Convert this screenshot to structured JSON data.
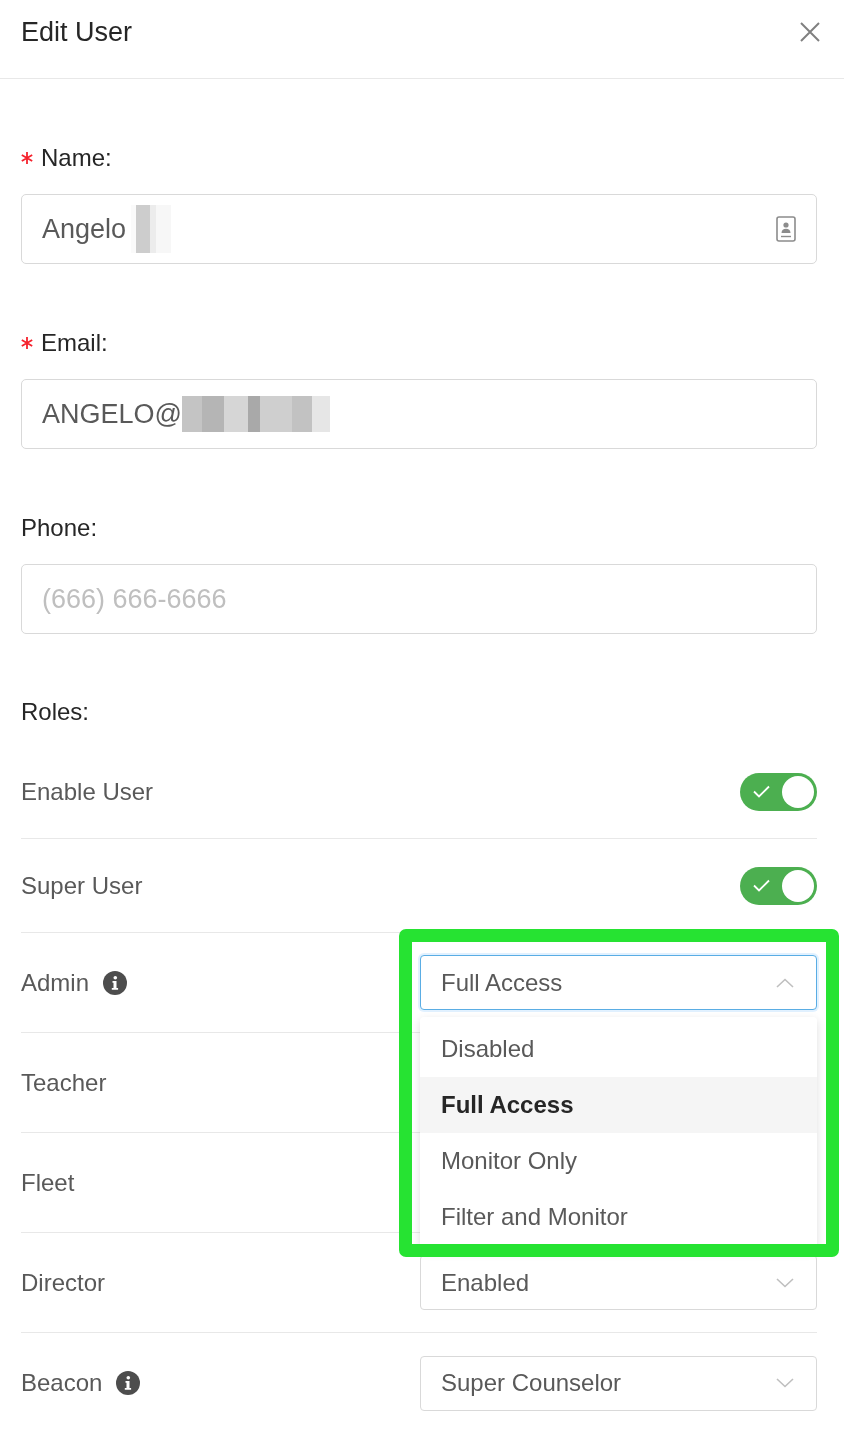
{
  "dialog": {
    "title": "Edit User"
  },
  "fields": [
    {
      "label": "Name:",
      "required": true,
      "kind": "contact",
      "value": "Angelo",
      "redacted": true
    },
    {
      "label": "Email:",
      "required": true,
      "kind": "plain",
      "value": "ANGELO@",
      "redacted": true
    },
    {
      "label": "Phone:",
      "required": false,
      "kind": "plain",
      "placeholder": "(666) 666-6666",
      "redacted": false
    }
  ],
  "roles": {
    "label": "Roles:",
    "items": [
      {
        "label": "Enable User",
        "kind": "toggle",
        "info": false,
        "on": true
      },
      {
        "label": "Super User",
        "kind": "toggle",
        "info": false,
        "on": true
      },
      {
        "label": "Admin",
        "kind": "select",
        "info": true,
        "value": "Full Access",
        "expanded": true,
        "highlighted": true,
        "options": [
          {
            "label": "Disabled",
            "selected": false
          },
          {
            "label": "Full Access",
            "selected": true
          },
          {
            "label": "Monitor Only",
            "selected": false
          },
          {
            "label": "Filter and Monitor",
            "selected": false
          }
        ]
      },
      {
        "label": "Teacher",
        "kind": "covered",
        "info": false
      },
      {
        "label": "Fleet",
        "kind": "covered",
        "info": false
      },
      {
        "label": "Director",
        "kind": "select",
        "info": false,
        "value": "Enabled",
        "expanded": false,
        "highlighted": false
      },
      {
        "label": "Beacon",
        "kind": "select",
        "info": true,
        "value": "Super Counselor",
        "expanded": false,
        "highlighted": false
      }
    ]
  }
}
